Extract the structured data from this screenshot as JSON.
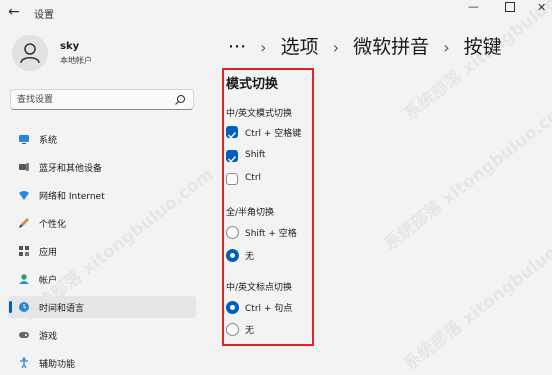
{
  "window": {
    "title": "设置"
  },
  "user": {
    "name": "sky",
    "account_type": "本地帐户"
  },
  "search": {
    "placeholder": "查找设置"
  },
  "nav": [
    {
      "label": "系统",
      "icon": "monitor-icon"
    },
    {
      "label": "蓝牙和其他设备",
      "icon": "bluetooth-icon"
    },
    {
      "label": "网络和 Internet",
      "icon": "wifi-icon"
    },
    {
      "label": "个性化",
      "icon": "brush-icon"
    },
    {
      "label": "应用",
      "icon": "apps-icon"
    },
    {
      "label": "帐户",
      "icon": "person-icon"
    },
    {
      "label": "时间和语言",
      "icon": "globe-clock-icon",
      "active": true
    },
    {
      "label": "游戏",
      "icon": "gamepad-icon"
    },
    {
      "label": "辅助功能",
      "icon": "accessibility-icon"
    }
  ],
  "breadcrumb": {
    "ellipsis": "···",
    "item1": "选项",
    "item2": "微软拼音",
    "current": "按键"
  },
  "section": {
    "title": "模式切换",
    "group1": {
      "label": "中/英文模式切换",
      "options": [
        {
          "label": "Ctrl + 空格键",
          "checked": true
        },
        {
          "label": "Shift",
          "checked": true
        },
        {
          "label": "Ctrl",
          "checked": false
        }
      ]
    },
    "group2": {
      "label": "全/半角切换",
      "options": [
        {
          "label": "Shift + 空格",
          "selected": false
        },
        {
          "label": "无",
          "selected": true
        }
      ]
    },
    "group3": {
      "label": "中/英文标点切换",
      "options": [
        {
          "label": "Ctrl + 句点",
          "selected": true
        },
        {
          "label": "无",
          "selected": false
        }
      ]
    }
  },
  "colors": {
    "accent": "#005fb8",
    "highlight_box": "#e02424",
    "background": "#f3f3f3"
  },
  "watermark": "系统部落 xitongbuluo.com"
}
